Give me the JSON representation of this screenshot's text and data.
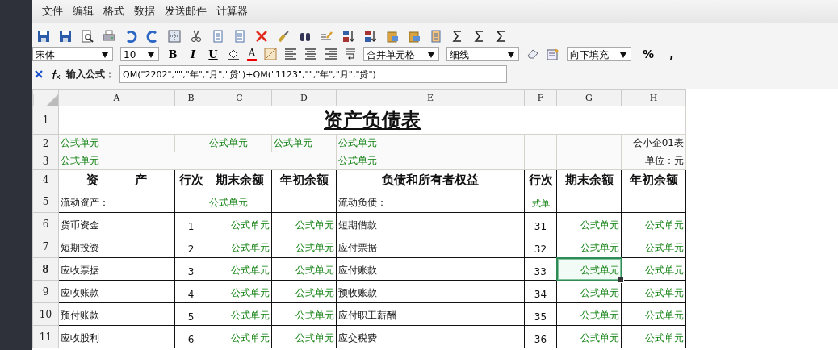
{
  "menu": [
    {
      "label": "文件"
    },
    {
      "label": "编辑"
    },
    {
      "label": "格式"
    },
    {
      "label": "数据"
    },
    {
      "label": "发送邮件"
    },
    {
      "label": "计算器"
    }
  ],
  "format_bar": {
    "font": "宋体",
    "size": "10",
    "bold": "B",
    "italic": "I",
    "underline": "U",
    "font_color": "A",
    "merge": "合并单元格",
    "line": "细线",
    "fill": "向下填充",
    "percent": "%",
    "comma": ","
  },
  "formula_bar": {
    "label": "输入公式：",
    "value": "QM(\"2202\",\"\",\"年\",\"月\",\"贷\")+QM(\"1123\",\"\",\"年\",\"月\",\"贷\")"
  },
  "sheet": {
    "columns": [
      "A",
      "B",
      "C",
      "D",
      "E",
      "F",
      "G",
      "H"
    ],
    "rows": [
      {
        "header": "1",
        "selected": false,
        "cells": [
          {
            "kind": "title",
            "text": "资产负债表",
            "colspan": 8,
            "selected": false
          }
        ]
      },
      {
        "header": "2",
        "selected": false,
        "cells": [
          {
            "kind": "formula",
            "text": "公式单元",
            "selected": false
          },
          {
            "kind": "empty",
            "selected": false
          },
          {
            "kind": "formula",
            "text": "公式单元",
            "selected": false
          },
          {
            "kind": "formula",
            "text": "公式单元",
            "selected": false
          },
          {
            "kind": "formula",
            "text": "公式单元",
            "selected": false
          },
          {
            "kind": "empty",
            "selected": false
          },
          {
            "kind": "empty",
            "selected": false
          },
          {
            "kind": "note",
            "text": "会小企01表",
            "selected": false
          }
        ]
      },
      {
        "header": "3",
        "selected": false,
        "cells": [
          {
            "kind": "formula",
            "text": "公式单元",
            "colspan": 4,
            "selected": false
          },
          {
            "kind": "formula",
            "text": "公式单元",
            "selected": false
          },
          {
            "kind": "empty",
            "selected": false
          },
          {
            "kind": "empty",
            "selected": false
          },
          {
            "kind": "note",
            "text": "单位：元",
            "selected": false
          }
        ]
      },
      {
        "header": "4",
        "selected": false,
        "cells": [
          {
            "kind": "heading",
            "text": "资　　　产",
            "selected": false
          },
          {
            "kind": "heading",
            "text": "行次",
            "selected": false
          },
          {
            "kind": "heading",
            "text": "期末余额",
            "selected": false
          },
          {
            "kind": "heading",
            "text": "年初余额",
            "selected": false
          },
          {
            "kind": "heading",
            "text": "负债和所有者权益",
            "selected": false
          },
          {
            "kind": "heading",
            "text": "行次",
            "selected": false
          },
          {
            "kind": "heading",
            "text": "期末余额",
            "selected": false
          },
          {
            "kind": "heading",
            "text": "年初余额",
            "selected": false
          }
        ]
      },
      {
        "header": "5",
        "selected": false,
        "cells": [
          {
            "kind": "text",
            "text": "流动资产：",
            "selected": false
          },
          {
            "kind": "empty",
            "selected": false
          },
          {
            "kind": "formula",
            "text": "公式单元",
            "selected": false
          },
          {
            "kind": "empty",
            "selected": false
          },
          {
            "kind": "text",
            "text": "流动负债：",
            "selected": false
          },
          {
            "kind": "clipped",
            "text": "式单",
            "selected": false
          },
          {
            "kind": "empty",
            "selected": false
          },
          {
            "kind": "empty",
            "selected": false
          }
        ]
      },
      {
        "header": "6",
        "selected": false,
        "cells": [
          {
            "kind": "text",
            "text": "货币资金",
            "selected": false
          },
          {
            "kind": "number",
            "text": "1",
            "selected": false
          },
          {
            "kind": "amount",
            "text": "公式单元",
            "selected": false
          },
          {
            "kind": "amount",
            "text": "公式单元",
            "selected": false
          },
          {
            "kind": "text",
            "text": "短期借款",
            "selected": false
          },
          {
            "kind": "number",
            "text": "31",
            "selected": false
          },
          {
            "kind": "amount",
            "text": "公式单元",
            "selected": false
          },
          {
            "kind": "amount",
            "text": "公式单元",
            "selected": false
          }
        ]
      },
      {
        "header": "7",
        "selected": false,
        "cells": [
          {
            "kind": "text",
            "text": "短期投资",
            "selected": false
          },
          {
            "kind": "number",
            "text": "2",
            "selected": false
          },
          {
            "kind": "amount",
            "text": "公式单元",
            "selected": false
          },
          {
            "kind": "amount",
            "text": "公式单元",
            "selected": false
          },
          {
            "kind": "text",
            "text": "应付票据",
            "selected": false
          },
          {
            "kind": "number",
            "text": "32",
            "selected": false
          },
          {
            "kind": "amount",
            "text": "公式单元",
            "selected": false
          },
          {
            "kind": "amount",
            "text": "公式单元",
            "selected": false
          }
        ]
      },
      {
        "header": "8",
        "selected": true,
        "cells": [
          {
            "kind": "text",
            "text": "应收票据",
            "selected": false
          },
          {
            "kind": "number",
            "text": "3",
            "selected": false
          },
          {
            "kind": "amount",
            "text": "公式单元",
            "selected": false
          },
          {
            "kind": "amount",
            "text": "公式单元",
            "selected": false
          },
          {
            "kind": "text",
            "text": "应付账款",
            "selected": false
          },
          {
            "kind": "number",
            "text": "33",
            "selected": false
          },
          {
            "kind": "amount",
            "text": "公式单元",
            "selected": true
          },
          {
            "kind": "amount",
            "text": "公式单元",
            "selected": false
          }
        ]
      },
      {
        "header": "9",
        "selected": false,
        "cells": [
          {
            "kind": "text",
            "text": "应收账款",
            "selected": false
          },
          {
            "kind": "number",
            "text": "4",
            "selected": false
          },
          {
            "kind": "amount",
            "text": "公式单元",
            "selected": false
          },
          {
            "kind": "amount",
            "text": "公式单元",
            "selected": false
          },
          {
            "kind": "text",
            "text": "预收账款",
            "selected": false
          },
          {
            "kind": "number",
            "text": "34",
            "selected": false
          },
          {
            "kind": "amount",
            "text": "公式单元",
            "selected": false
          },
          {
            "kind": "amount",
            "text": "公式单元",
            "selected": false
          }
        ]
      },
      {
        "header": "10",
        "selected": false,
        "cells": [
          {
            "kind": "text",
            "text": "预付账款",
            "selected": false
          },
          {
            "kind": "number",
            "text": "5",
            "selected": false
          },
          {
            "kind": "amount",
            "text": "公式单元",
            "selected": false
          },
          {
            "kind": "amount",
            "text": "公式单元",
            "selected": false
          },
          {
            "kind": "text",
            "text": "应付职工薪酬",
            "selected": false
          },
          {
            "kind": "number",
            "text": "35",
            "selected": false
          },
          {
            "kind": "amount",
            "text": "公式单元",
            "selected": false
          },
          {
            "kind": "amount",
            "text": "公式单元",
            "selected": false
          }
        ]
      },
      {
        "header": "11",
        "selected": false,
        "cells": [
          {
            "kind": "text",
            "text": "应收股利",
            "selected": false
          },
          {
            "kind": "number",
            "text": "6",
            "selected": false
          },
          {
            "kind": "amount",
            "text": "公式单元",
            "selected": false
          },
          {
            "kind": "amount",
            "text": "公式单元",
            "selected": false
          },
          {
            "kind": "text",
            "text": "应交税费",
            "selected": false
          },
          {
            "kind": "number",
            "text": "36",
            "selected": false
          },
          {
            "kind": "amount",
            "text": "公式单元",
            "selected": false
          },
          {
            "kind": "amount",
            "text": "公式单元",
            "selected": false
          }
        ]
      }
    ]
  }
}
